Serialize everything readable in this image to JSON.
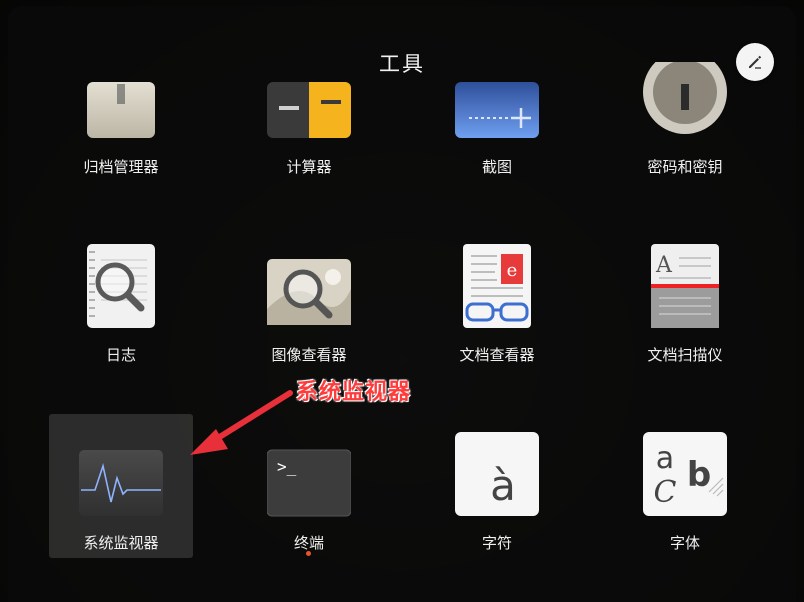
{
  "folder": {
    "title": "工具",
    "edit_icon": "edit-pencil-icon"
  },
  "rows": [
    [
      {
        "label": "归档管理器",
        "icon": "archive-manager-icon"
      },
      {
        "label": "计算器",
        "icon": "calculator-icon"
      },
      {
        "label": "截图",
        "icon": "screenshot-icon"
      },
      {
        "label": "密码和密钥",
        "icon": "passwords-keys-icon"
      }
    ],
    [
      {
        "label": "日志",
        "icon": "logs-icon"
      },
      {
        "label": "图像查看器",
        "icon": "image-viewer-icon"
      },
      {
        "label": "文档查看器",
        "icon": "document-viewer-icon"
      },
      {
        "label": "文档扫描仪",
        "icon": "document-scanner-icon"
      }
    ],
    [
      {
        "label": "系统监视器",
        "icon": "system-monitor-icon",
        "selected": true
      },
      {
        "label": "终端",
        "icon": "terminal-icon",
        "running": true
      },
      {
        "label": "字符",
        "icon": "characters-icon"
      },
      {
        "label": "字体",
        "icon": "fonts-icon"
      }
    ]
  ],
  "annotation": {
    "text": "系统监视器",
    "color": "#ff3b3b"
  },
  "colors": {
    "accent": "#e9542f",
    "calc_yellow": "#f5b41d",
    "screenshot_blue": "#4e7bd1"
  }
}
